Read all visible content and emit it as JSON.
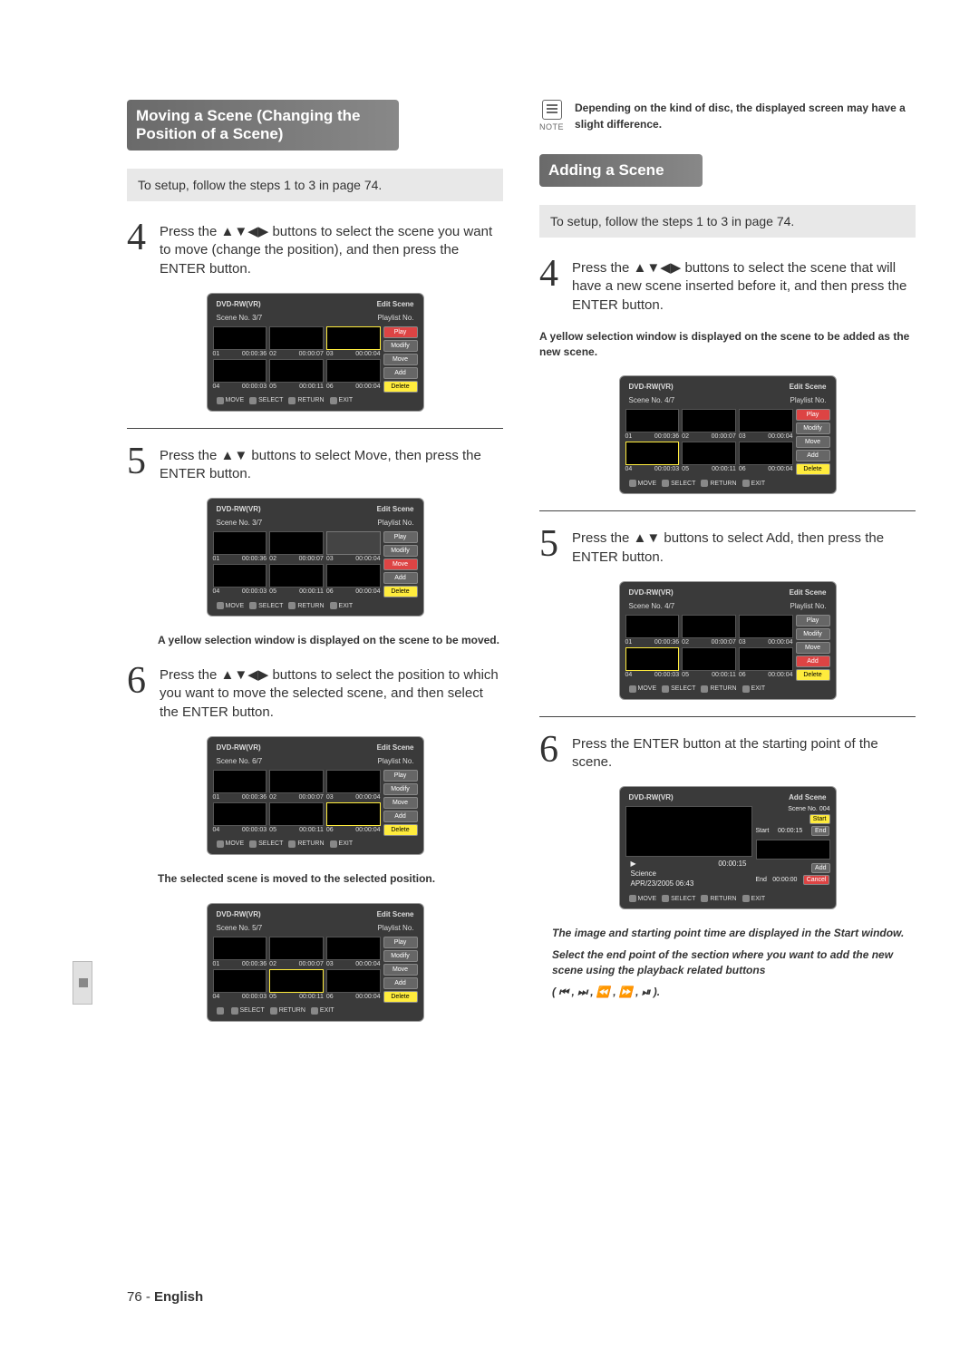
{
  "left": {
    "header": "Moving a Scene (Changing the Position of a Scene)",
    "setup": "To setup, follow the steps 1 to 3 in page 74.",
    "step4": {
      "num": "4",
      "text": "Press the ▲▼◀▶ buttons to select the scene you want to move (change the position), and then press the ENTER button."
    },
    "step5": {
      "num": "5",
      "text": "Press the ▲▼ buttons to select Move, then press the ENTER button."
    },
    "note5": "A yellow selection window is displayed on the scene to be moved.",
    "step6": {
      "num": "6",
      "text": "Press the ▲▼◀▶ buttons to select the position to which you want to move the selected scene, and then select the ENTER button."
    },
    "note6": "The selected scene is moved to the selected position."
  },
  "right": {
    "note": {
      "label": "NOTE",
      "text": "Depending on the kind of disc, the displayed screen may have a slight difference."
    },
    "header": "Adding a Scene",
    "setup": "To setup, follow the steps 1 to 3 in page 74.",
    "step4": {
      "num": "4",
      "text": "Press the ▲▼◀▶ buttons to select the scene that will have a new scene inserted before it, and then press the ENTER button."
    },
    "note4": "A yellow selection window is displayed on the scene to be added as the new scene.",
    "step5": {
      "num": "5",
      "text": "Press the ▲▼ buttons to select Add, then press the ENTER button."
    },
    "step6": {
      "num": "6",
      "text": "Press the ENTER button at the starting point of the scene."
    },
    "notes6a": "The image and starting point time are displayed in the Start window.",
    "notes6b": "Select the end point of the section where you want to add the new scene using the playback related buttons",
    "notes6c": "( ⏮ , ⏭ , ⏪ , ⏩ , ⏯ )."
  },
  "screens": {
    "grid": {
      "top_left": "DVD-RW(VR)",
      "top_right": "Edit Scene",
      "sub_left": "Scene No.",
      "sub_right": "Playlist No.",
      "cells": [
        {
          "n": "01",
          "t": "00:00:36"
        },
        {
          "n": "02",
          "t": "00:00:07"
        },
        {
          "n": "03",
          "t": "00:00:04"
        },
        {
          "n": "04",
          "t": "00:00:03"
        },
        {
          "n": "05",
          "t": "00:00:11"
        },
        {
          "n": "06",
          "t": "00:00:04"
        }
      ],
      "side": [
        "Play",
        "Modify",
        "Move",
        "Add",
        "Delete"
      ],
      "bot": [
        "MOVE",
        "SELECT",
        "RETURN",
        "EXIT"
      ]
    },
    "add": {
      "top_left": "DVD-RW(VR)",
      "top_right": "Add Scene",
      "scene_no": "Scene No. 004",
      "start": "Start",
      "end": "End",
      "add": "Add",
      "cancel": "Cancel",
      "start_t": "00:00:15",
      "end_t": "00:00:00",
      "pb_t": "00:00:15",
      "science": "Science",
      "date": "APR/23/2005 06:43",
      "bot": [
        "MOVE",
        "SELECT",
        "RETURN",
        "EXIT"
      ]
    },
    "counts": {
      "s37": "3/7",
      "s47": "4/7",
      "s57": "5/7",
      "s67": "6/7"
    }
  },
  "footer": {
    "page": "76 - ",
    "lang": "English"
  }
}
